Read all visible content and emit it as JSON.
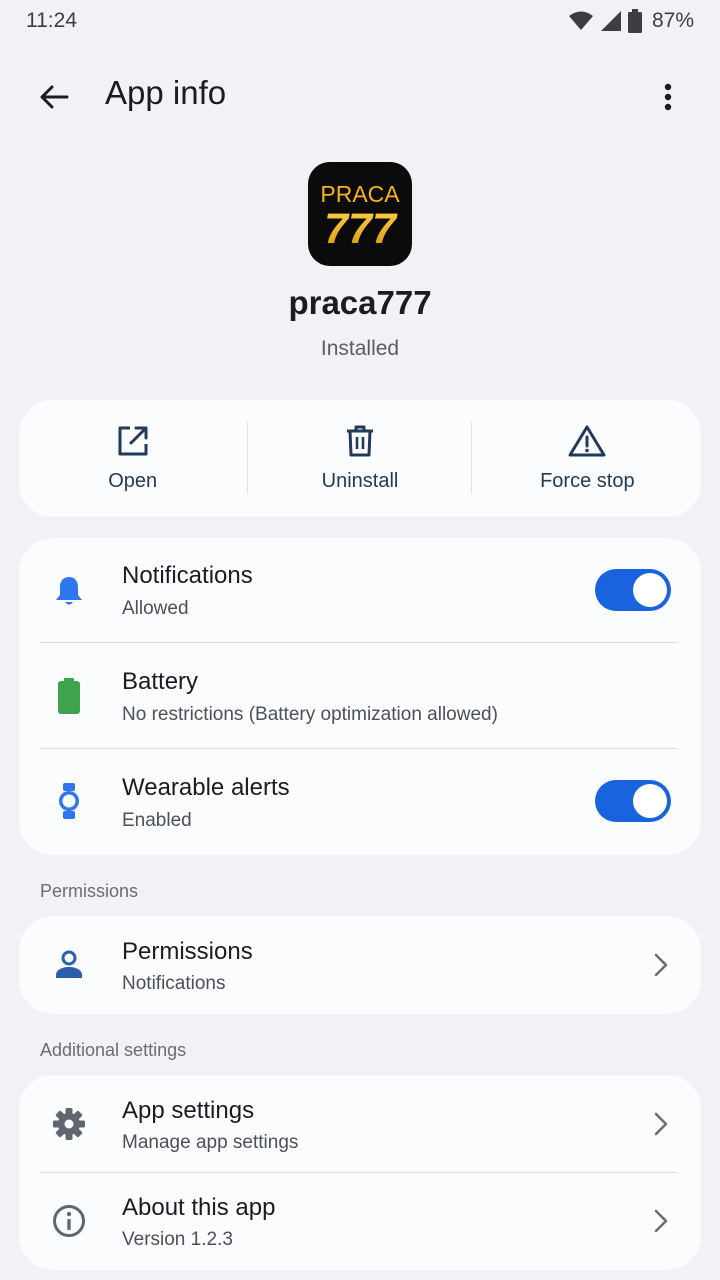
{
  "status_bar": {
    "time": "11:24",
    "battery_percent": "87%",
    "icons": [
      "wifi-icon",
      "cellular-signal-icon",
      "battery-icon"
    ]
  },
  "app_bar": {
    "title": "App info",
    "back_icon": "arrow-back-icon",
    "menu_icon": "more-vert-icon"
  },
  "app": {
    "icon_text_top": "PRACA",
    "icon_text_bottom": "777",
    "name": "praca777",
    "status": "Installed"
  },
  "actions": [
    {
      "label": "Open",
      "icon": "open-external-icon"
    },
    {
      "label": "Uninstall",
      "icon": "trash-icon"
    },
    {
      "label": "Force stop",
      "icon": "warning-icon"
    }
  ],
  "settings_card": {
    "notifications": {
      "title": "Notifications",
      "subtitle": "Allowed",
      "enabled": true,
      "icon": "bell-icon"
    },
    "battery": {
      "title": "Battery",
      "subtitle": "No restrictions (Battery optimization allowed)",
      "icon": "battery-full-icon"
    },
    "wearable": {
      "title": "Wearable alerts",
      "subtitle": "Enabled",
      "enabled": true,
      "icon": "watch-icon"
    }
  },
  "permissions_section": {
    "header": "Permissions",
    "item": {
      "title": "Permissions",
      "subtitle": "Notifications",
      "icon": "person-icon"
    }
  },
  "additional_section": {
    "header": "Additional settings",
    "items": [
      {
        "title": "App settings",
        "subtitle": "Manage app settings",
        "icon": "gear-icon"
      },
      {
        "title": "About this app",
        "subtitle": "Version 1.2.3",
        "icon": "info-icon"
      }
    ]
  },
  "colors": {
    "background": "#f1f2f6",
    "card": "#fbfcfd",
    "accent": "#1a63df",
    "action_text": "#223a59",
    "bell": "#2f74f0",
    "battery": "#3fa34d",
    "icon_gold": "#f2b416"
  }
}
